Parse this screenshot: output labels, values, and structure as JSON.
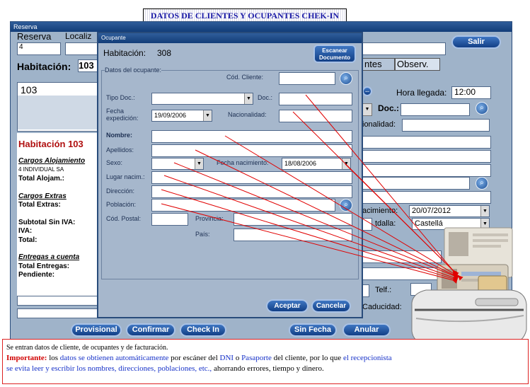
{
  "banner": {
    "title": "DATOS DE CLIENTES Y OCUPANTES CHEK-IN"
  },
  "main_window": {
    "title": "Reserva",
    "reserva_label": "Reserva",
    "localizador_label": "Localiz",
    "reserva_value": "4",
    "salir_button": "Salir",
    "habitacion_label": "Habitación:",
    "habitacion_value": "103",
    "tabs": [
      {
        "label": "ntes"
      },
      {
        "label": "Observ."
      }
    ],
    "room_list_value": "103",
    "hora_llegada_label": "Hora llegada:",
    "hora_llegada_value": "12:00",
    "doc_label": "Doc.:",
    "nacionalidad_label": "ionalidad:",
    "nacimiento_label": "acimiento:",
    "nacimiento_value": "20/07/2012",
    "poblacion_label": "tdalla:",
    "poblacion_value": "Castellá",
    "telf_label": "Telf.:",
    "caducidad_label": "Caducidad:",
    "summary": {
      "habitacion_title": "Habitación 103",
      "cargos_alojamiento": "Cargos Alojamiento",
      "alojamiento_line": "4      INDIVIDUAL SA",
      "total_alojam": "Total Alojam.:",
      "cargos_extras": "Cargos Extras",
      "total_extras": "Total Extras:",
      "subtotal": "Subtotal Sin IVA:",
      "iva": "IVA:",
      "total": "Total:",
      "entregas": "Entregas a cuenta",
      "total_entregas": "Total Entregas:",
      "pendiente": "Pendiente:"
    },
    "bottom_buttons": [
      "Provisional",
      "Confirmar",
      "Check In",
      "Sin Fecha",
      "Anular"
    ]
  },
  "dialog": {
    "title": "Ocupante",
    "habitacion_label": "Habitación:",
    "habitacion_value": "308",
    "scan_button_line1": "Escanear",
    "scan_button_line2": "Documento",
    "group_label": "Datos del ocupante:",
    "cod_cliente_label": "Cód. Cliente:",
    "tipo_doc_label": "Tipo Doc.:",
    "doc_label": "Doc.:",
    "fecha_exp_label1": "Fecha",
    "fecha_exp_label2": "expedición:",
    "fecha_exp_value": "19/09/2006",
    "nacionalidad_label": "Nacionalidad:",
    "nombre_label": "Nombre:",
    "apellidos_label": "Apellidos:",
    "sexo_label": "Sexo:",
    "fecha_nac_label": "Fecha nacimiento:",
    "fecha_nac_value": "18/08/2006",
    "lugar_nac_label": "Lugar nacim.:",
    "direccion_label": "Dirección:",
    "poblacion_label": "Población:",
    "cod_postal_label": "Cód. Postal:",
    "provincia_label": "Provincia:",
    "pais_label": "País:",
    "aceptar_button": "Aceptar",
    "cancelar_button": "Cancelar"
  },
  "note": {
    "line1": "Se entran datos de cliente, de ocupantes y de facturación.",
    "importante": "Importante:",
    "t1": " los ",
    "b1": "datos se obtienen automáticamente",
    "t2": " por escáner del ",
    "b2": "DNI",
    "t3": " o ",
    "b3": "Pasaporte",
    "t4": " del cliente, por lo que ",
    "b4": "el recepcionista",
    "t5": "se evita leer y escribir los nombres, direcciones, poblaciones, etc.,",
    "t6": "  ahorrando errores, tiempo y dinero."
  },
  "colors": {
    "arrow": "#e00000",
    "window_bg": "#9fb3c9",
    "titlebar": "#1f4c88",
    "button": "#2458a4"
  }
}
